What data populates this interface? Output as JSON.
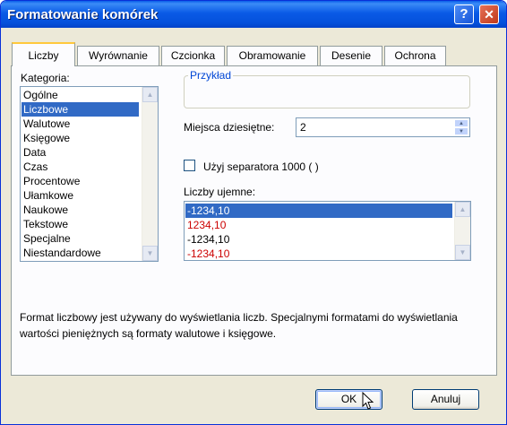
{
  "window": {
    "title": "Formatowanie komórek"
  },
  "titlebar_buttons": {
    "help": "?",
    "close": "✕"
  },
  "tabs": [
    {
      "label": "Liczby",
      "active": true
    },
    {
      "label": "Wyrównanie"
    },
    {
      "label": "Czcionka"
    },
    {
      "label": "Obramowanie"
    },
    {
      "label": "Desenie"
    },
    {
      "label": "Ochrona"
    }
  ],
  "category": {
    "label": "Kategoria:",
    "items": [
      "Ogólne",
      "Liczbowe",
      "Walutowe",
      "Księgowe",
      "Data",
      "Czas",
      "Procentowe",
      "Ułamkowe",
      "Naukowe",
      "Tekstowe",
      "Specjalne",
      "Niestandardowe"
    ],
    "selected": "Liczbowe"
  },
  "sample": {
    "label": "Przykład",
    "value": ""
  },
  "decimals": {
    "label": "Miejsca dziesiętne:",
    "value": "2"
  },
  "separator": {
    "label": "Użyj separatora 1000 ( )",
    "checked": false
  },
  "negative": {
    "label": "Liczby ujemne:",
    "items": [
      {
        "text": "-1234,10",
        "color": "#000000",
        "selected": true
      },
      {
        "text": "1234,10",
        "color": "#CC0000"
      },
      {
        "text": "-1234,10",
        "color": "#000000"
      },
      {
        "text": "-1234,10",
        "color": "#CC0000"
      }
    ]
  },
  "description": "Format liczbowy jest używany do wyświetlania liczb. Specjalnymi formatami do wyświetlania wartości pieniężnych są formaty walutowe i księgowe.",
  "buttons": {
    "ok": "OK",
    "cancel": "Anuluj"
  },
  "colors": {
    "selection": "#316AC5",
    "negative_red": "#CC0000",
    "accent": "#0046D5"
  }
}
